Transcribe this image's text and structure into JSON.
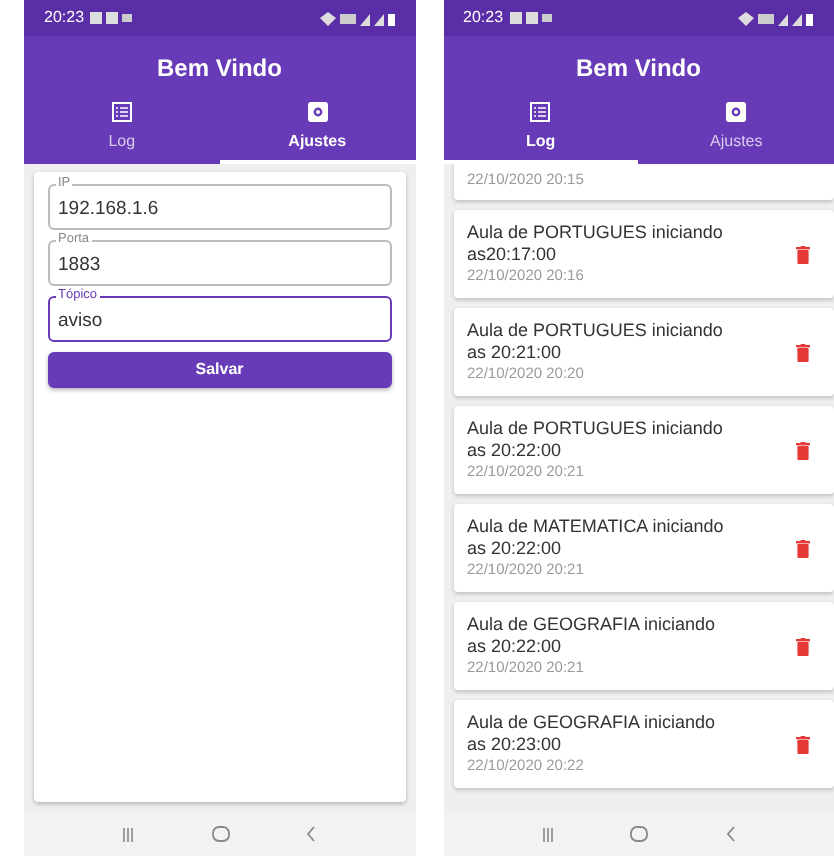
{
  "phones": [
    {
      "status_time": "20:23",
      "title": "Bem Vindo",
      "tabs": [
        {
          "label": "Log",
          "selected": false,
          "kind": "list"
        },
        {
          "label": "Ajustes",
          "selected": true,
          "kind": "settings"
        }
      ],
      "screen": {
        "kind": "settings",
        "fields": [
          {
            "label": "IP",
            "value": "192.168.1.6",
            "focused": false
          },
          {
            "label": "Porta",
            "value": "1883",
            "focused": false
          },
          {
            "label": "Tópico",
            "value": "aviso",
            "focused": true
          }
        ],
        "button": "Salvar"
      }
    },
    {
      "status_time": "20:23",
      "title": "Bem Vindo",
      "tabs": [
        {
          "label": "Log",
          "selected": true,
          "kind": "list"
        },
        {
          "label": "Ajustes",
          "selected": false,
          "kind": "settings"
        }
      ],
      "screen": {
        "kind": "log",
        "entries": [
          {
            "time": "22/10/2020 20:15"
          },
          {
            "message": "Aula de PORTUGUES iniciando as20:17:00",
            "time": "22/10/2020 20:16"
          },
          {
            "message": "Aula de PORTUGUES iniciando as 20:21:00",
            "time": "22/10/2020 20:20"
          },
          {
            "message": "Aula de PORTUGUES iniciando as 20:22:00",
            "time": "22/10/2020 20:21"
          },
          {
            "message": "Aula de MATEMATICA iniciando as 20:22:00",
            "time": "22/10/2020 20:21"
          },
          {
            "message": "Aula de GEOGRAFIA iniciando as 20:22:00",
            "time": "22/10/2020 20:21"
          },
          {
            "message": "Aula de GEOGRAFIA iniciando as 20:23:00",
            "time": "22/10/2020 20:22"
          }
        ]
      }
    }
  ]
}
